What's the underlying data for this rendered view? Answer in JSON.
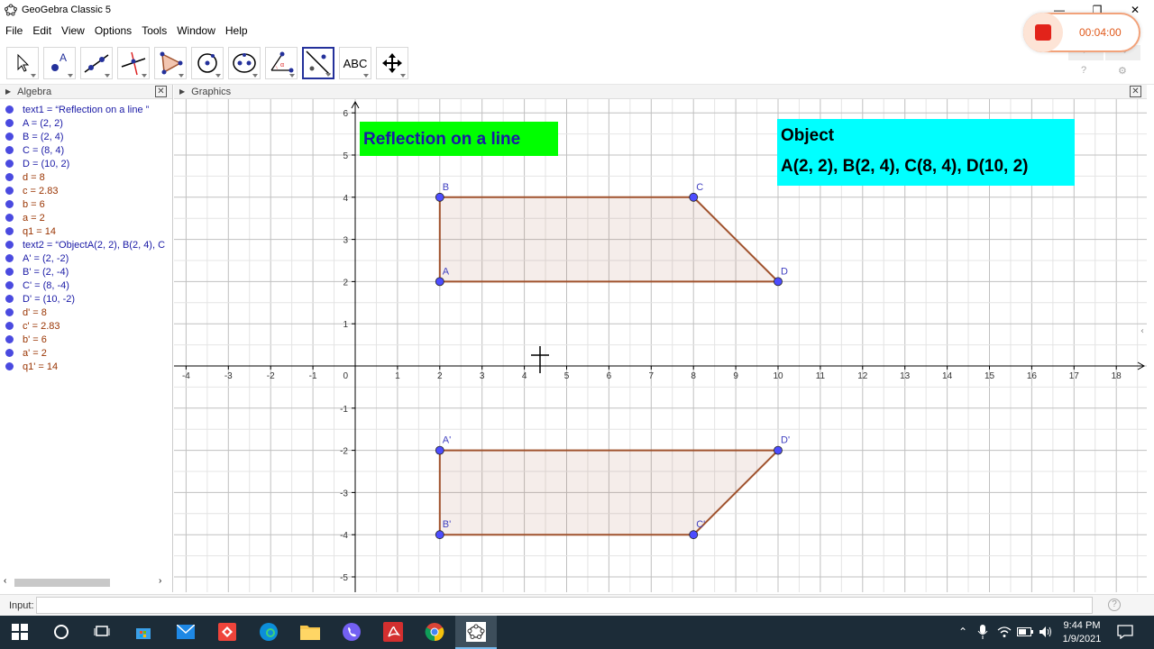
{
  "window": {
    "title": "GeoGebra Classic 5",
    "minimize": "—",
    "restore": "❐",
    "close": "✕"
  },
  "menu": [
    "File",
    "Edit",
    "View",
    "Options",
    "Tools",
    "Window",
    "Help"
  ],
  "toolbar": {
    "tools": [
      {
        "name": "move-tool-icon"
      },
      {
        "name": "point-tool-icon"
      },
      {
        "name": "line-tool-icon"
      },
      {
        "name": "perpendicular-line-tool-icon"
      },
      {
        "name": "polygon-tool-icon"
      },
      {
        "name": "circle-tool-icon"
      },
      {
        "name": "conic-tool-icon"
      },
      {
        "name": "angle-tool-icon"
      },
      {
        "name": "reflect-tool-icon"
      },
      {
        "name": "text-tool-icon"
      },
      {
        "name": "move-graphics-view-tool-icon"
      }
    ],
    "text_tool_label": "ABC",
    "selected_tool": "reflect-tool-icon",
    "undo": "↶",
    "redo": "↷"
  },
  "recorder": {
    "time": "00:04:00"
  },
  "algebra": {
    "title": "Algebra",
    "items": [
      {
        "text": "text1 = “Reflection on a line ”",
        "color": "#1a1aa6"
      },
      {
        "text": "A = (2, 2)",
        "color": "#1a1aa6"
      },
      {
        "text": "B = (2, 4)",
        "color": "#1a1aa6"
      },
      {
        "text": "C = (8, 4)",
        "color": "#1a1aa6"
      },
      {
        "text": "D = (10, 2)",
        "color": "#1a1aa6"
      },
      {
        "text": "d = 8",
        "color": "#993300"
      },
      {
        "text": "c = 2.83",
        "color": "#993300"
      },
      {
        "text": "b = 6",
        "color": "#993300"
      },
      {
        "text": "a = 2",
        "color": "#993300"
      },
      {
        "text": "q1 = 14",
        "color": "#993300"
      },
      {
        "text": "text2 = “ObjectA(2, 2), B(2, 4), C",
        "color": "#1a1aa6"
      },
      {
        "text": "A' = (2, -2)",
        "color": "#1a1aa6"
      },
      {
        "text": "B' = (2, -4)",
        "color": "#1a1aa6"
      },
      {
        "text": "C' = (8, -4)",
        "color": "#1a1aa6"
      },
      {
        "text": "D' = (10, -2)",
        "color": "#1a1aa6"
      },
      {
        "text": "d' = 8",
        "color": "#993300"
      },
      {
        "text": "c' = 2.83",
        "color": "#993300"
      },
      {
        "text": "b' = 6",
        "color": "#993300"
      },
      {
        "text": "a' = 2",
        "color": "#993300"
      },
      {
        "text": "q1' = 14",
        "color": "#993300"
      }
    ]
  },
  "graphics": {
    "title": "Graphics",
    "x_ticks": [
      -4,
      -3,
      -2,
      -1,
      1,
      2,
      3,
      4,
      5,
      6,
      7,
      8,
      9,
      10,
      11,
      12,
      13,
      14,
      15,
      16,
      17,
      18
    ],
    "y_ticks": [
      -5,
      -4,
      -3,
      -2,
      -1,
      1,
      2,
      3,
      4,
      5,
      6
    ],
    "origin_label": "0",
    "text1": {
      "text": "Reflection on a line",
      "bg": "#00ff00",
      "color": "#1a1aa6"
    },
    "text2": {
      "line1": "Object",
      "line2": "A(2, 2), B(2, 4), C(8, 4), D(10, 2)",
      "bg": "#00ffff",
      "color": "#000000"
    },
    "polygon1": {
      "points": [
        {
          "label": "A",
          "x": 2,
          "y": 2
        },
        {
          "label": "B",
          "x": 2,
          "y": 4
        },
        {
          "label": "C",
          "x": 8,
          "y": 4
        },
        {
          "label": "D",
          "x": 10,
          "y": 2
        }
      ]
    },
    "polygon2": {
      "points": [
        {
          "label": "A'",
          "x": 2,
          "y": -2
        },
        {
          "label": "B'",
          "x": 2,
          "y": -4
        },
        {
          "label": "C'",
          "x": 8,
          "y": -4
        },
        {
          "label": "D'",
          "x": 10,
          "y": -2
        }
      ]
    },
    "polygon_color": "#a0522d",
    "point_color": "#4d4dff"
  },
  "input": {
    "label": "Input:",
    "value": "",
    "help": "?"
  },
  "taskbar": {
    "time": "9:44 PM",
    "date": "1/9/2021"
  }
}
